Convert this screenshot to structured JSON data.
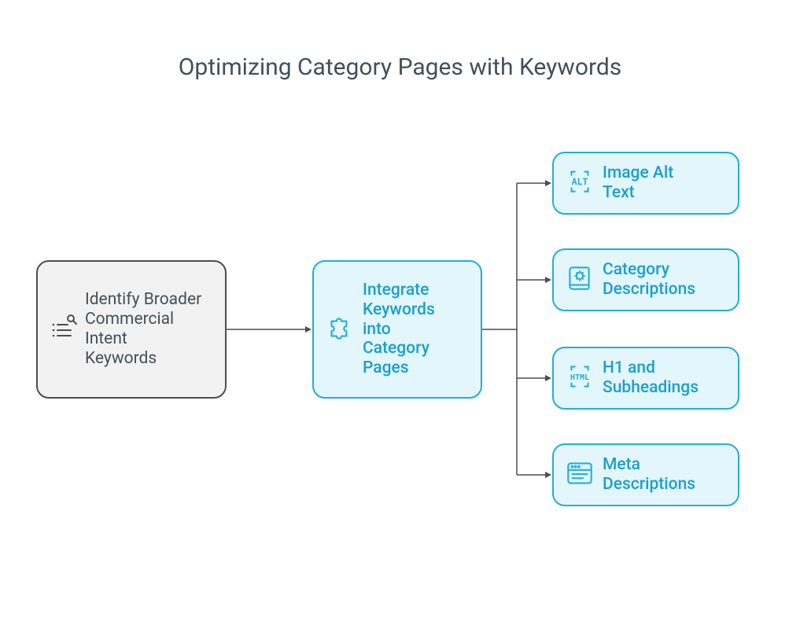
{
  "title": "Optimizing Category Pages with Keywords",
  "nodes": {
    "identify": {
      "label": "Identify Broader Commercial Intent Keywords"
    },
    "integrate": {
      "label": "Integrate Keywords into Category Pages"
    },
    "alt": {
      "label": "Image Alt Text"
    },
    "category_desc": {
      "label": "Category Descriptions"
    },
    "headings": {
      "label": "H1 and Subheadings"
    },
    "meta": {
      "label": "Meta Descriptions"
    }
  }
}
